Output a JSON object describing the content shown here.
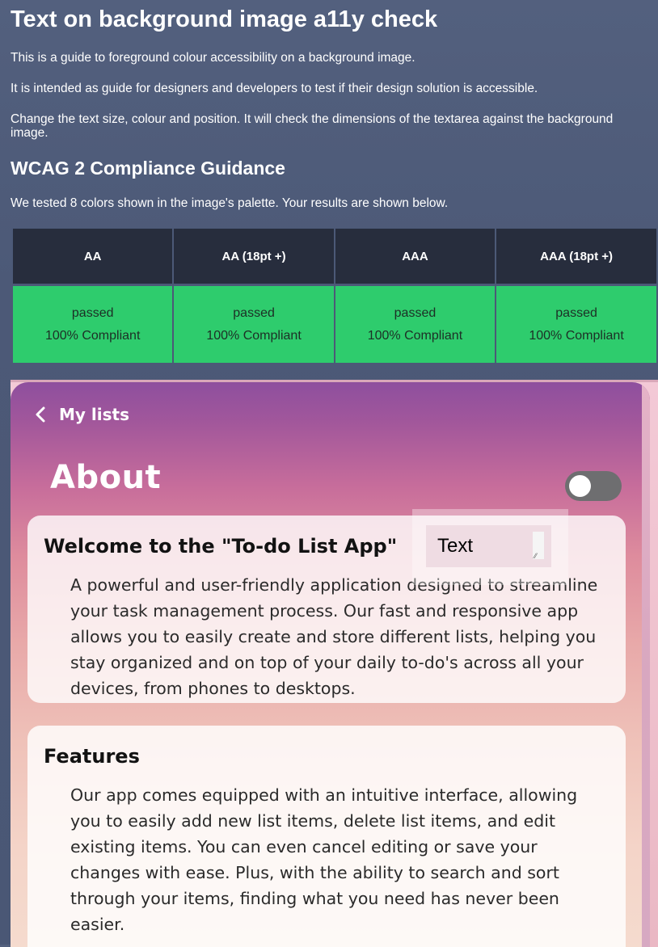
{
  "header": {
    "title": "Text on background image a11y check",
    "intro_1": "This is a guide to foreground colour accessibility on a background image.",
    "intro_2": "It is intended as guide for designers and developers to test if their design solution is accessible.",
    "intro_3": "Change the text size, colour and position. It will check the dimensions of the textarea against the background image."
  },
  "compliance": {
    "heading": "WCAG 2 Compliance Guidance",
    "summary": "We tested 8 colors shown in the image's palette. Your results are shown below.",
    "columns": [
      "AA",
      "AA (18pt +)",
      "AAA",
      "AAA (18pt +)"
    ],
    "results": [
      {
        "status": "passed",
        "score": "100% Compliant"
      },
      {
        "status": "passed",
        "score": "100% Compliant"
      },
      {
        "status": "passed",
        "score": "100% Compliant"
      },
      {
        "status": "passed",
        "score": "100% Compliant"
      }
    ],
    "pass_color": "#2ecc6d",
    "header_color": "#272d3d"
  },
  "preview": {
    "back_label": "My lists",
    "back_icon": "chevron-left-icon",
    "title": "About",
    "toggle_state": "off",
    "welcome_card": {
      "heading": "Welcome to the \"To-do List App\"",
      "body": "A powerful and user-friendly application designed to streamline your task management process. Our fast and responsive app allows you to easily create and store different lists, helping you stay organized and on top of your daily to-do's across all your devices, from phones to desktops."
    },
    "features_card": {
      "heading": "Features",
      "body": "Our app comes equipped with an intuitive interface, allowing you to easily add new list items, delete list items, and edit existing items. You can even cancel editing or save your changes with ease. Plus, with the ability to search and sort through your items, finding what you need has never been easier."
    },
    "textarea_value": "Text"
  }
}
